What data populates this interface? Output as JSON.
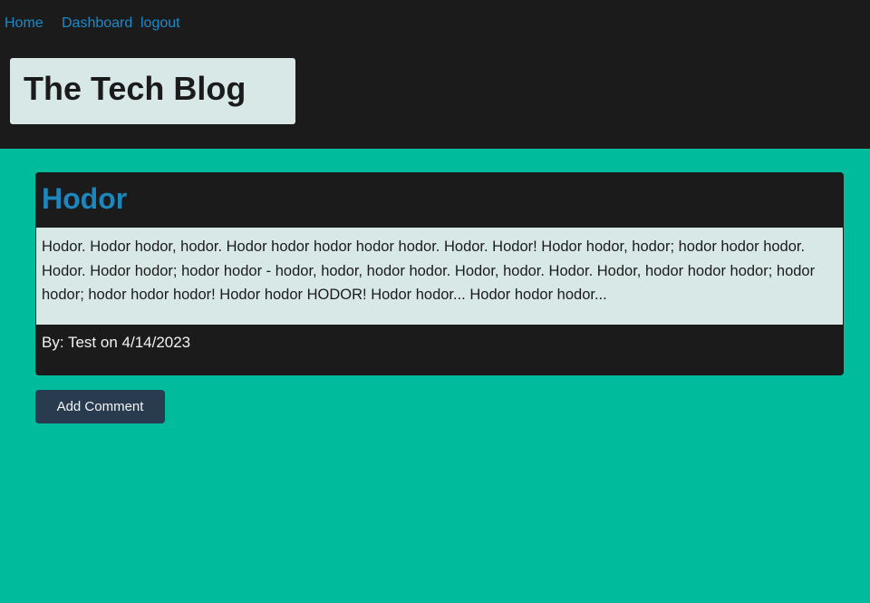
{
  "nav": {
    "home": "Home",
    "dashboard": "Dashboard",
    "logout": "logout"
  },
  "site": {
    "title": "The Tech Blog"
  },
  "post": {
    "title": "Hodor",
    "body": "Hodor. Hodor hodor, hodor. Hodor hodor hodor hodor hodor. Hodor. Hodor! Hodor hodor, hodor; hodor hodor hodor. Hodor. Hodor hodor; hodor hodor - hodor, hodor, hodor hodor. Hodor, hodor. Hodor. Hodor, hodor hodor hodor; hodor hodor; hodor hodor hodor! Hodor hodor HODOR! Hodor hodor... Hodor hodor hodor...",
    "meta": "By: Test on 4/14/2023"
  },
  "actions": {
    "add_comment": "Add Comment"
  },
  "colors": {
    "page_background": "#00bb9c",
    "header_background": "#1b1b1b",
    "link": "#1c8ac9",
    "post_title": "#1c86bd",
    "panel": "#d8e8e7",
    "button": "#283b4f"
  }
}
